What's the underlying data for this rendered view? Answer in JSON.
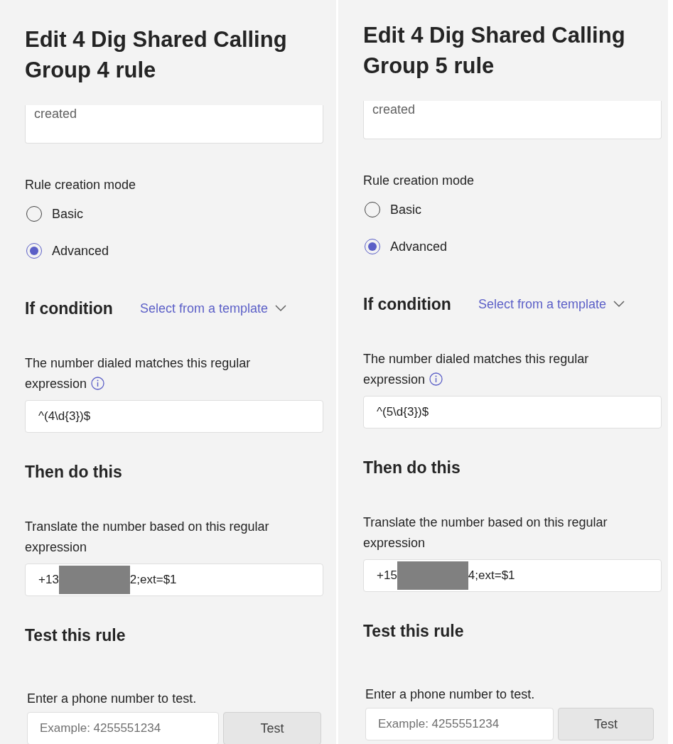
{
  "panels": [
    {
      "title": "Edit 4 Dig Shared Calling Group 4 rule",
      "description_value": "created",
      "mode_label": "Rule creation mode",
      "modes": [
        {
          "label": "Basic",
          "selected": false
        },
        {
          "label": "Advanced",
          "selected": true
        }
      ],
      "condition_heading": "If condition",
      "template_link": "Select from a template",
      "regex_label": "The number dialed matches this regular expression",
      "regex_value": "^(4\\d{3})$",
      "action_heading": "Then do this",
      "translate_label": "Translate the number based on this regular expression",
      "translate_value_start": "+13",
      "translate_value_end": "2;ext=$1",
      "test_heading": "Test this rule",
      "test_label": "Enter a phone number to test.",
      "test_placeholder": "Example: 4255551234",
      "test_button": "Test"
    },
    {
      "title": "Edit 4 Dig Shared Calling Group 5 rule",
      "description_value": "created",
      "mode_label": "Rule creation mode",
      "modes": [
        {
          "label": "Basic",
          "selected": false
        },
        {
          "label": "Advanced",
          "selected": true
        }
      ],
      "condition_heading": "If condition",
      "template_link": "Select from a template",
      "regex_label": "The number dialed matches this regular expression",
      "regex_value": "^(5\\d{3})$",
      "action_heading": "Then do this",
      "translate_label": "Translate the number based on this regular expression",
      "translate_value_start": "+15",
      "translate_value_end": "4;ext=$1",
      "test_heading": "Test this rule",
      "test_label": "Enter a phone number to test.",
      "test_placeholder": "Example: 4255551234",
      "test_button": "Test"
    }
  ]
}
